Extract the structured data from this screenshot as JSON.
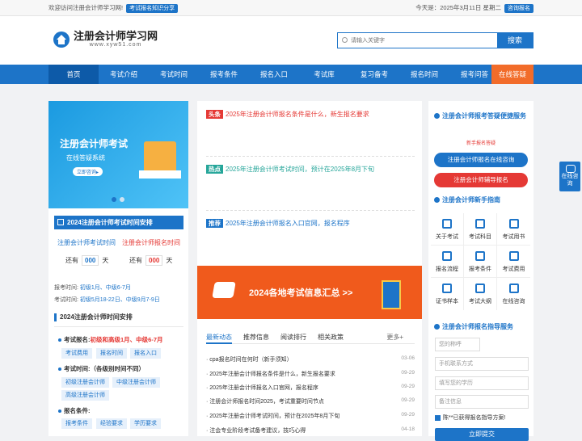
{
  "topbar": {
    "welcome": "欢迎访问注册会计师学习网!",
    "share_btn": "考试报名知识分享",
    "date": "今天是：2025年3月11日 星期二",
    "consult_btn": "咨询报名"
  },
  "header": {
    "site_title": "注册会计师学习网",
    "site_url": "www.xyw51.com",
    "search_placeholder": "请输入关键字",
    "search_btn": "搜索"
  },
  "nav": [
    "首页",
    "考试介绍",
    "考试时间",
    "报考条件",
    "报名入口",
    "考试库",
    "复习备考",
    "报名时间",
    "报考问答"
  ],
  "nav_online": "在线答疑",
  "banner": {
    "title": "注册会计师考试",
    "subtitle": "在线答疑系统",
    "cta": "立即咨询▸"
  },
  "schedule": {
    "title": "2024注册会计师考试时间安排",
    "exam_time_label": "注册会计师考试时间",
    "reg_time_label": "注册会计师报名时间",
    "left_prefix": "还有",
    "days": "000",
    "suffix": "天",
    "apply_time_label": "报考时间:",
    "apply_time_val": "初级1月、中级6-7月",
    "exam_time2_label": "考试时间:",
    "exam_time2_val": "初级5月18-22日、中级9月7-9日"
  },
  "arrange": {
    "title": "2024注册会计师时间安排",
    "exam_reg_label": "考试报名:",
    "exam_reg_val": "初级和高级1月、中级6-7月",
    "tags1": [
      "考试费用",
      "报名时间",
      "报名入口"
    ],
    "exam_time_label": "考试时间:",
    "exam_time_val": "（各级别时间不同）",
    "tags2": [
      "初级注册会计师",
      "中级注册会计师",
      "高级注册会计师"
    ],
    "reg_cond_label": "报名条件:",
    "tags3": [
      "报考条件",
      "经验要求",
      "学历要求"
    ]
  },
  "headlines": [
    {
      "badge": "头条",
      "text": "2025年注册会计师报名条件是什么，新生报名要求",
      "color": "#e53935"
    },
    {
      "badge": "热点",
      "text": "2025年注册会计师考试时间，预计在2025年8月下旬",
      "color": "#26a69a"
    },
    {
      "badge": "推荐",
      "text": "2025年注册会计师报名入口官网，报名程序",
      "color": "#1d74c8"
    }
  ],
  "ad_text": "2024各地考试信息汇总 >>",
  "tabs": [
    "最新动态",
    "推荐信息",
    "阅读排行",
    "相关政策"
  ],
  "tabs_more": "更多+",
  "list": [
    {
      "t": "cpa报名时间在何时（新手须知）",
      "d": "03-06"
    },
    {
      "t": "2025年注册会计师报名条件是什么，新生报名要求",
      "d": "09-29"
    },
    {
      "t": "2025年注册会计师报名入口官网，报名程序",
      "d": "09-29"
    },
    {
      "t": "注册会计师报名时间2025，考试重要时间节点",
      "d": "09-29"
    },
    {
      "t": "2025年注册会计师考试时间，预计在2025年8月下旬",
      "d": "09-29"
    },
    {
      "t": "注会专业阶段考试备考建议，技巧心得",
      "d": "04-18"
    }
  ],
  "right": {
    "service_title": "注册会计师报考答疑便捷服务",
    "service_sub": "新手报名答疑",
    "btn1": "注册会计师报名在线咨询",
    "btn2": "注册会计师辅导报名",
    "guide_title": "注册会计师新手指南",
    "guide": [
      "关于考试",
      "考试科目",
      "考试用书",
      "报名流程",
      "报考条件",
      "考试费用",
      "证书样本",
      "考试大纲",
      "在线咨询"
    ],
    "form_title": "注册会计师报名指导服务",
    "f1": "您的称呼",
    "f2": "手机联系方式",
    "f3": "填写您的学历",
    "f4": "备注信息",
    "check": "陈**已获得报名指导方案!",
    "submit": "立即提交"
  },
  "float": "在线咨询"
}
